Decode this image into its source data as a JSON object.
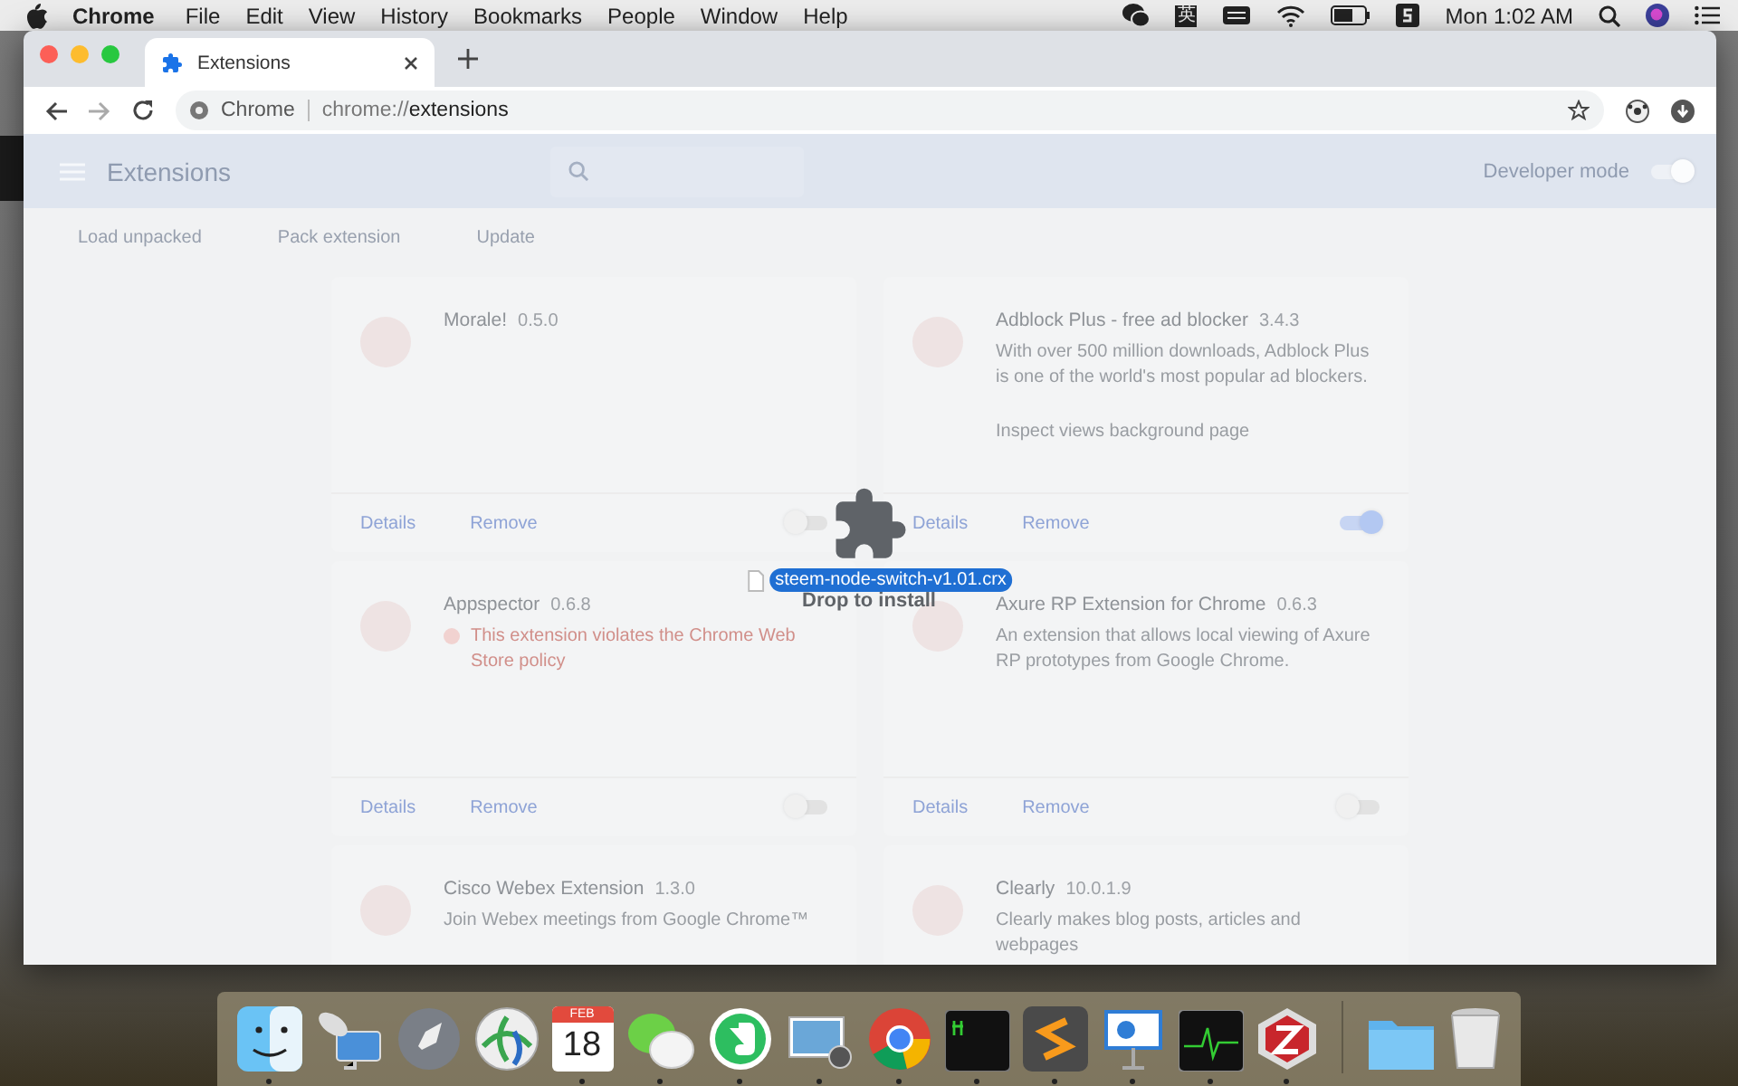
{
  "menubar": {
    "app": "Chrome",
    "menus": [
      "File",
      "Edit",
      "View",
      "History",
      "Bookmarks",
      "People",
      "Window",
      "Help"
    ],
    "input_source": "英",
    "clock": "Mon 1:02 AM"
  },
  "browser": {
    "tab": {
      "title": "Extensions"
    },
    "omnibox": {
      "site": "Chrome",
      "url_prefix": "chrome://",
      "url_path": "extensions"
    }
  },
  "page": {
    "title": "Extensions",
    "developer_mode": {
      "label": "Developer mode",
      "on": true
    },
    "actions": [
      "Load unpacked",
      "Pack extension",
      "Update"
    ],
    "extensions": [
      {
        "name": "Morale!",
        "version": "0.5.0",
        "on": false,
        "details": "Details",
        "remove": "Remove"
      },
      {
        "name": "Adblock Plus - free ad blocker",
        "version": "3.4.3",
        "description": "With over 500 million downloads, Adblock Plus is one of the world's most popular ad blockers.",
        "link": "Inspect views background page",
        "on": true,
        "details": "Details",
        "remove": "Remove"
      },
      {
        "name": "Appspector",
        "version": "0.6.8",
        "warning": "This extension violates the Chrome Web Store policy",
        "on": false,
        "details": "Details",
        "remove": "Remove"
      },
      {
        "name": "Axure RP Extension for Chrome",
        "version": "0.6.3",
        "description": "An extension that allows local viewing of Axure RP prototypes from Google Chrome.",
        "on": false,
        "details": "Details",
        "remove": "Remove"
      },
      {
        "name": "Cisco Webex Extension",
        "version": "1.3.0",
        "description": "Join Webex meetings from Google Chrome™"
      },
      {
        "name": "Clearly",
        "version": "10.0.1.9",
        "description": "Clearly makes blog posts, articles and webpages"
      }
    ]
  },
  "drag": {
    "file_name": "steem-node-switch-v1.01.crx",
    "hint": "Drop to install"
  },
  "dock": {
    "calendar_month": "FEB",
    "calendar_day": "18"
  }
}
